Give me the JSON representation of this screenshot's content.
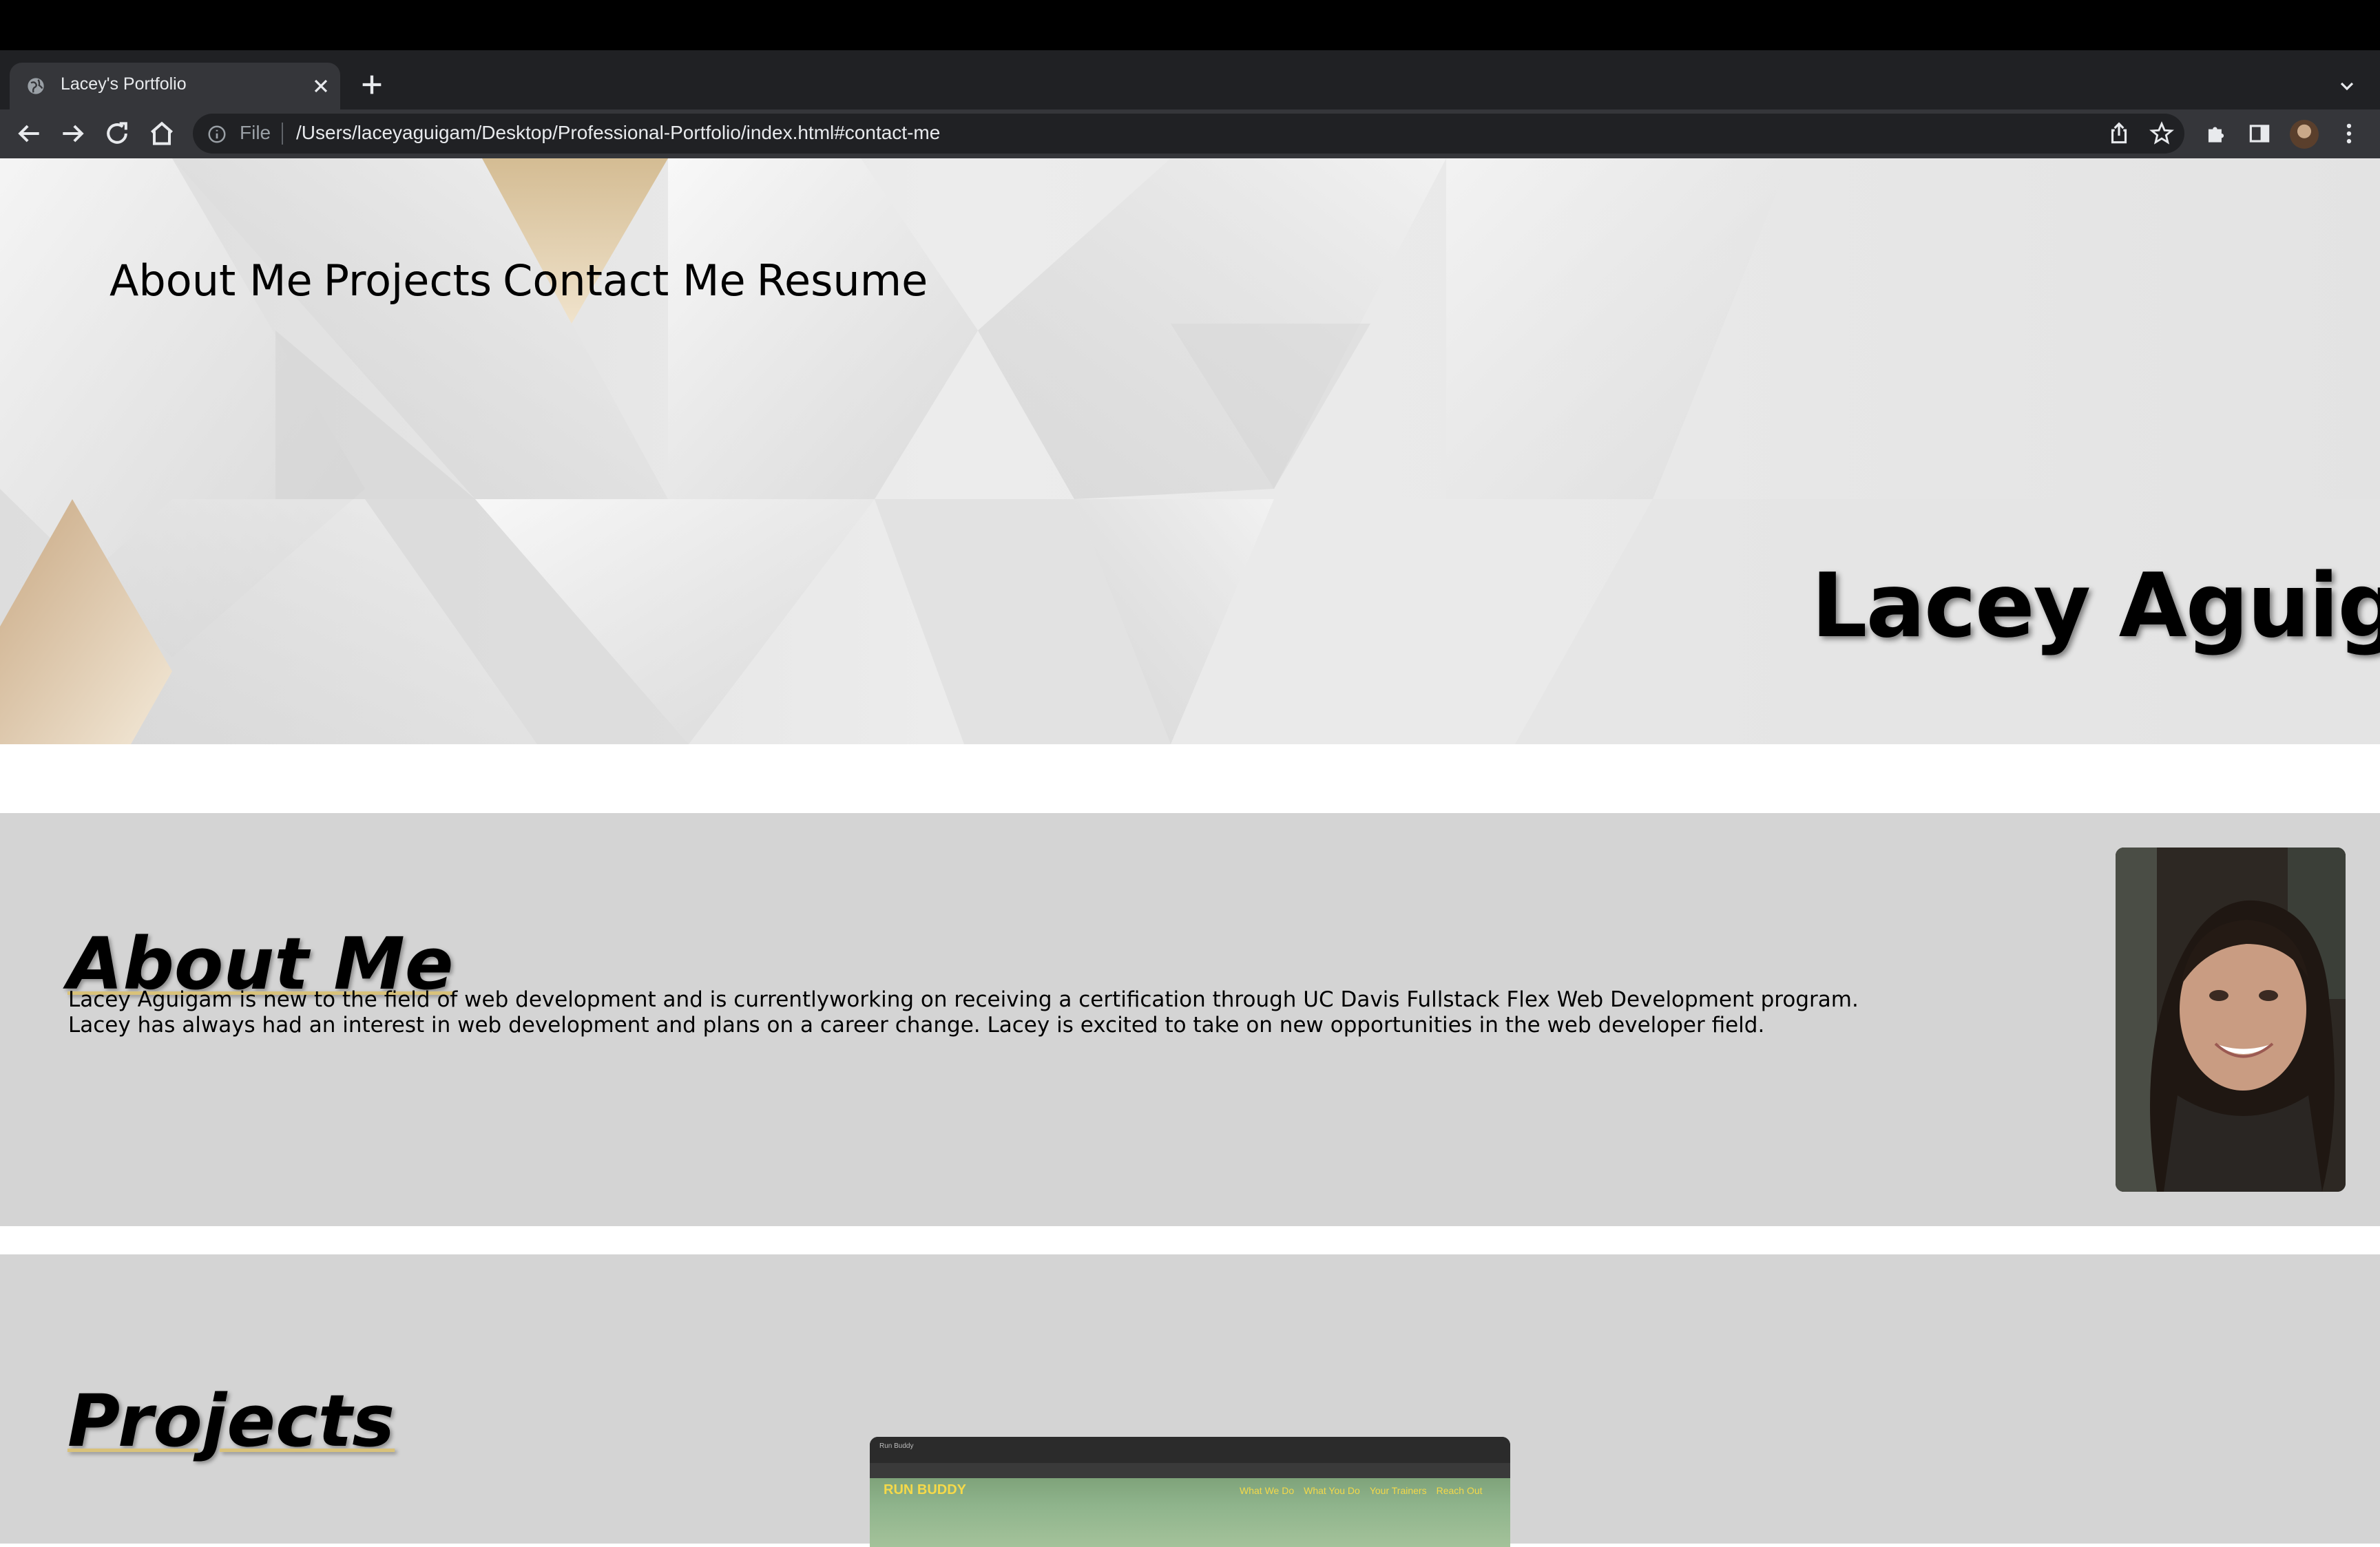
{
  "browser": {
    "tab_title": "Lacey's Portfolio",
    "address_scheme": "File",
    "address_url": "/Users/laceyaguigam/Desktop/Professional-Portfolio/index.html#contact-me"
  },
  "nav": {
    "links": [
      "About Me",
      "Projects",
      "Contact Me",
      "Resume"
    ]
  },
  "hero": {
    "name": "Lacey Aguigam"
  },
  "about": {
    "title": "About Me",
    "paragraph_lines": [
      "Lacey Aguigam is new to the field of web development and is currentlyworking on receiving a certification through UC Davis Fullstack Flex Web Development program.",
      "Lacey has always had an interest in web development and plans on a career change. Lacey is excited to take on new opportunities in the web developer field."
    ]
  },
  "projects": {
    "title": "Projects",
    "first_project_preview": {
      "tab_text": "Run Buddy",
      "brand": "RUN BUDDY",
      "links": [
        "What We Do",
        "What You Do",
        "Your Trainers",
        "Reach Out"
      ]
    }
  },
  "colors": {
    "accent_underline": "#d9c27a",
    "section_bg": "#d4d4d4"
  }
}
